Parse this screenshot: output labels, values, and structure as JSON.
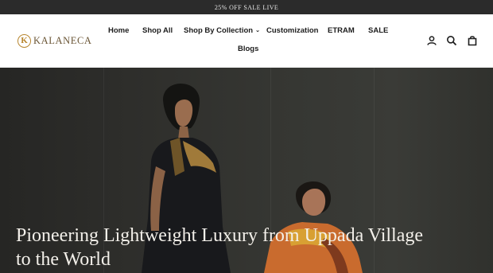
{
  "announcement": "25% OFF SALE LIVE",
  "brand": {
    "mark": "K",
    "name": "KALANECA"
  },
  "nav": {
    "home": "Home",
    "shop_all": "Shop All",
    "shop_by_collection": "Shop By Collection",
    "customization": "Customization",
    "etram": "ETRAM",
    "sale": "SALE",
    "blogs": "Blogs"
  },
  "header_icons": [
    "account-icon",
    "search-icon",
    "cart-icon"
  ],
  "hero": {
    "title": "Pioneering Lightweight Luxury from Uppada Village to the World"
  }
}
